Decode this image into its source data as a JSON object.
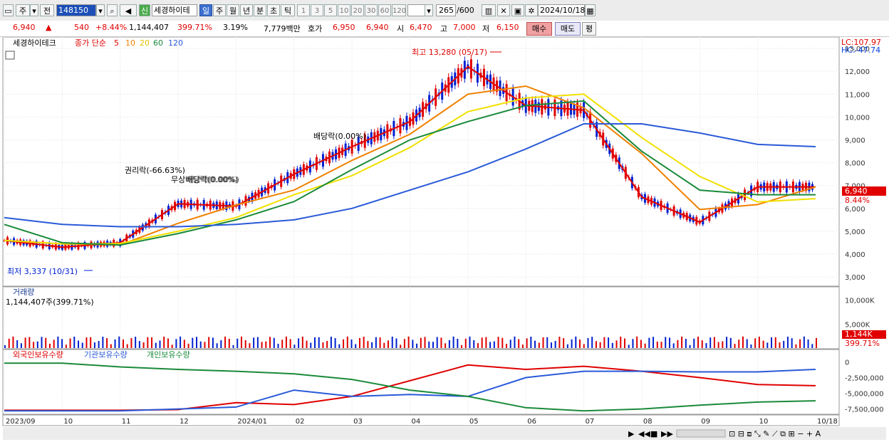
{
  "toolbar": {
    "period_label": "주",
    "market_label": "전",
    "stock_code": "148150",
    "stock_badge": "신",
    "stock_name": "세경하이테",
    "interval_tabs": [
      "일",
      "주",
      "월",
      "년",
      "분",
      "초",
      "틱"
    ],
    "active_tab": "일",
    "interval_nums": [
      "1",
      "3",
      "5",
      "10",
      "20",
      "30",
      "60",
      "120"
    ],
    "count_value": "265",
    "count_total": "/600",
    "date": "2024/10/18"
  },
  "quote": {
    "price": "6,940",
    "arrow": "▲",
    "change": "540",
    "change_pct": "+8.44%",
    "volume": "1,144,407",
    "volume_ratio": "399.71%",
    "turnover": "3.19%",
    "amount": "7,779백만",
    "hoga_label": "호가",
    "ask": "6,950",
    "bid": "6,940",
    "open_label": "시",
    "open": "6,470",
    "high_label": "고",
    "high": "7,000",
    "low_label": "저",
    "low": "6,150",
    "buy_label": "매수",
    "sell_label": "매도",
    "flat_label": "평"
  },
  "legend": {
    "stock_name": "세경하이테크",
    "ma_title": "종가 단순",
    "ma_periods": [
      "5",
      "10",
      "20",
      "60",
      "120"
    ],
    "ma_colors": [
      "#e00000",
      "#f08000",
      "#e0c000",
      "#1a8a3a",
      "#2a5ad8"
    ]
  },
  "right_labels": {
    "lc": "LC:107.97",
    "hc": "HC:-47.74"
  },
  "annotations": {
    "high": "최고 13,280 (05/17)",
    "low": "최저 3,337 (10/31)",
    "dividend1": "배당락(0.00%)",
    "rights": "권리락(-66.63%)",
    "bonus": "무상배당락(0.00%)",
    "dividend2": "배당락(0.00%)"
  },
  "price_badge": {
    "price": "6,940",
    "pct": "8.44%"
  },
  "volume_panel": {
    "title": "거래량",
    "value": "1,144,407주(399.71%)",
    "axis_labels": [
      "10,000K",
      "5,000K"
    ],
    "badge": "1,144K",
    "badge_pct": "399.71%"
  },
  "holdings_panel": {
    "series": [
      "외국인보유수량",
      "기관보유수량",
      "개인보유수량"
    ],
    "axis_labels": [
      "0",
      "-2,500,000",
      "-5,000,000",
      "-7,500,000"
    ]
  },
  "x_axis": {
    "labels": [
      "2023/09",
      "10",
      "11",
      "12",
      "2024/01",
      "02",
      "03",
      "04",
      "05",
      "06",
      "07",
      "08",
      "09",
      "10",
      "10/18"
    ]
  },
  "colors": {
    "up": "#e00000",
    "down": "#0020d0",
    "ma5": "#e00000",
    "ma10": "#f08000",
    "ma20": "#f0e000",
    "ma60": "#1a8a3a",
    "ma120": "#2a5ad8",
    "foreign": "#e00000",
    "institution": "#2a5ad8",
    "individual": "#1a8a3a"
  },
  "chart_data": {
    "type": "candlestick",
    "y_ticks": [
      3000,
      4000,
      5000,
      6000,
      7000,
      8000,
      9000,
      10000,
      11000,
      12000,
      13000
    ],
    "x": [
      "2023-09",
      "2023-10",
      "2023-11",
      "2023-12",
      "2024-01",
      "2024-02",
      "2024-03",
      "2024-04",
      "2024-05",
      "2024-06",
      "2024-07",
      "2024-08",
      "2024-09",
      "2024-10",
      "2024-10-18"
    ],
    "close": [
      4600,
      4300,
      4500,
      6200,
      6100,
      7500,
      8700,
      9800,
      12200,
      10500,
      10300,
      6500,
      5400,
      6940,
      6940
    ],
    "ma60": [
      5300,
      4500,
      4400,
      4900,
      5500,
      6300,
      7700,
      9000,
      9800,
      10500,
      10700,
      8500,
      6800,
      6600,
      6600
    ],
    "ma120": [
      5600,
      5300,
      5200,
      5200,
      5300,
      5500,
      6000,
      6800,
      7600,
      8600,
      9700,
      9700,
      9300,
      8800,
      8700
    ],
    "volume_axis": [
      5000,
      10000
    ],
    "holdings_axis": [
      0,
      -2500000,
      -5000000,
      -7500000
    ],
    "last": 6940,
    "high": 13280,
    "low": 3337
  }
}
